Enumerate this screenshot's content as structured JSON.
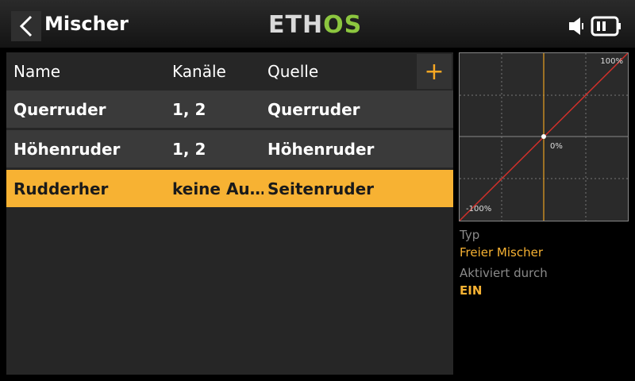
{
  "header": {
    "title": "Mischer",
    "logo_part1": "ETH",
    "logo_part2": "OS",
    "logo_color_main": "#d9d9d9",
    "logo_color_accent": "#8cc63f"
  },
  "table": {
    "columns": [
      "Name",
      "Kanäle",
      "Quelle"
    ],
    "add_label": "+",
    "rows": [
      {
        "name": "Querruder",
        "channels": "1, 2",
        "source": "Querruder",
        "selected": false
      },
      {
        "name": "Höhenruder",
        "channels": "1, 2",
        "source": "Höhenruder",
        "selected": false
      },
      {
        "name": "Rudderher",
        "channels": "keine Au…",
        "source": "Seitenruder",
        "selected": true
      }
    ]
  },
  "curve": {
    "top_label": "100%",
    "center_label": "0%",
    "bottom_label": "-100%"
  },
  "details": {
    "type_label": "Typ",
    "type_value": "Freier Mischer",
    "activated_label": "Aktiviert durch",
    "activated_value": "EIN"
  },
  "colors": {
    "accent": "#f7b233",
    "curve_line": "#d0302a",
    "cursor_line": "#e8a020"
  }
}
